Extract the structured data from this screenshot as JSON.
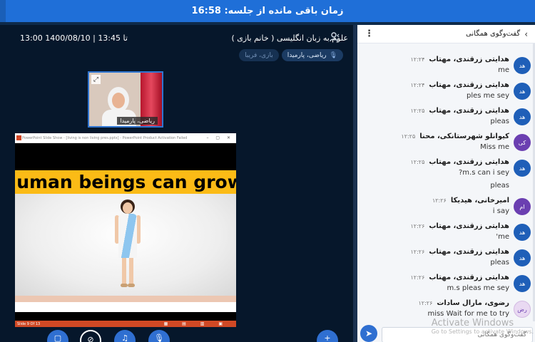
{
  "topbar": {
    "title": "زمان باقی مانده از جلسه: 16:58"
  },
  "session": {
    "title": "علوم به زبان انگلیسی ( خانم بازی )",
    "date": "1400/08/10",
    "time_range": "13:00 تا 13:45"
  },
  "pills": {
    "speaker_label": "ریاضی، پارمیدا",
    "muted_label": "بازی، فریبا"
  },
  "webcam": {
    "name_tag": "ریاضی، پارمیدا"
  },
  "slide": {
    "window_title": "PowerPoint Slide Show - [living is non living pres.pptx] - PowerPoint Product Activation Failed",
    "text": "Human beings can grow.",
    "footer_status": "Slide 9 Of 13"
  },
  "colors": {
    "topbar": "#1f6fd8",
    "background": "#06172b",
    "accent": "#2f6fd1",
    "slide_band": "#fbbb16"
  },
  "chat": {
    "header_title": "گفت‌وگوی همگانی",
    "input_placeholder": "گفت‌وگوی همگانی",
    "messages": [
      {
        "avatar": "هد",
        "avatar_style": "blue",
        "name": "هدایتی زرقندی، مهتاب",
        "time": "۱۲:۲۴",
        "text": "me"
      },
      {
        "avatar": "هد",
        "avatar_style": "blue",
        "name": "هدایتی زرقندی، مهتاب",
        "time": "۱۲:۲۴",
        "text": "ples me sey"
      },
      {
        "avatar": "هد",
        "avatar_style": "blue",
        "name": "هدایتی زرقندی، مهتاب",
        "time": "۱۲:۲۵",
        "text": "pleas"
      },
      {
        "avatar": "کی",
        "avatar_style": "purple",
        "name": "کیوانلو شهرستانکی، محنا",
        "time": "۱۲:۲۵",
        "text": "Miss me"
      },
      {
        "avatar": "هد",
        "avatar_style": "blue",
        "name": "هدایتی زرقندی، مهتاب",
        "time": "۱۲:۲۵",
        "text": "?m.s can i sey"
      },
      {
        "avatar": "",
        "avatar_style": "none",
        "name": "",
        "time": "",
        "text": "pleas"
      },
      {
        "avatar": "ام",
        "avatar_style": "purple",
        "name": "امیرخانی، هیدیکا",
        "time": "۱۲:۲۶",
        "text": "i say"
      },
      {
        "avatar": "هد",
        "avatar_style": "blue",
        "name": "هدایتی زرقندی، مهتاب",
        "time": "۱۲:۲۶",
        "text": "'me"
      },
      {
        "avatar": "هد",
        "avatar_style": "blue",
        "name": "هدایتی زرقندی، مهتاب",
        "time": "۱۲:۲۶",
        "text": "pleas"
      },
      {
        "avatar": "هد",
        "avatar_style": "blue",
        "name": "هدایتی زرقندی، مهتاب",
        "time": "۱۲:۲۶",
        "text": "m.s pleas me sey"
      },
      {
        "avatar": "رض",
        "avatar_style": "lilac",
        "name": "رضوی، مارال سادات",
        "time": "۱۲:۲۶",
        "text": "miss Wait for me to try"
      }
    ]
  },
  "watermark": {
    "line1": "Activate Windows",
    "line2": "Go to Settings to activate Windows."
  },
  "icons": {
    "user": "user-icon",
    "kebab": "kebab-menu-icon",
    "back": "chevron-icon",
    "send": "send-icon",
    "mic": "microphone-icon",
    "expand": "expand-icon"
  }
}
